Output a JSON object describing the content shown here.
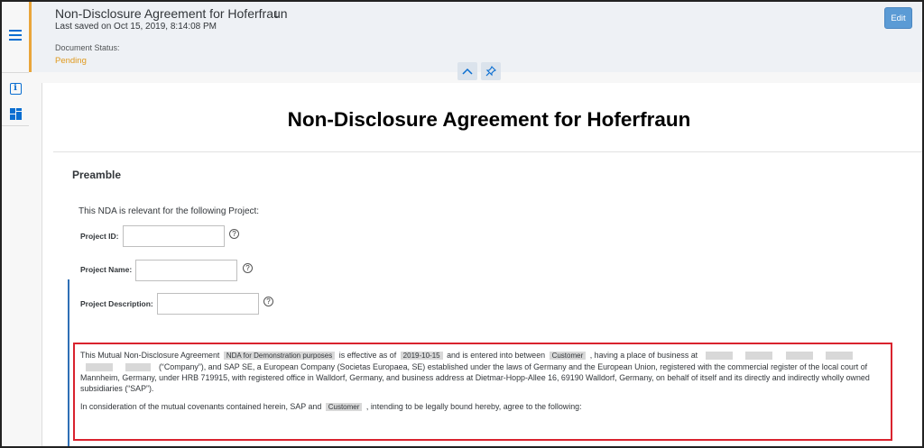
{
  "header": {
    "title": "Non-Disclosure Agreement for Hoferfraun",
    "count": "1",
    "last_saved": "Last saved on Oct 15, 2019, 8:14:08 PM",
    "status_label": "Document Status:",
    "status_value": "Pending",
    "edit_label": "Edit"
  },
  "document": {
    "heading": "Non-Disclosure Agreement for Hoferfraun",
    "section_title": "Preamble",
    "intro": "This NDA is relevant for the following Project:",
    "fields": {
      "project_id_label": "Project ID:",
      "project_name_label": "Project Name:",
      "project_description_label": "Project Description:",
      "help_glyph": "?"
    },
    "paragraph1": {
      "t1": "This Mutual Non-Disclosure Agreement",
      "tok_purpose": "NDA for Demonstration purposes",
      "t2": "is effective as of",
      "tok_date": "2019-10-15",
      "t3": "and is entered into between",
      "tok_customer": "Customer",
      "t4": ", having a place of business at",
      "t5": "(“Company”), and SAP SE, a European Company (Societas Europaea, SE) established under the laws of Germany and the European Union, registered with the commercial register of the local court of Mannheim, Germany, under HRB 719915, with registered office in Walldorf, Germany, and business address at Dietmar-Hopp-Allee 16, 69190 Walldorf, Germany, on behalf of itself and its directly and indirectly wholly owned subsidiaries (“SAP”)."
    },
    "paragraph2": {
      "t1": "In consideration of the mutual covenants contained herein, SAP and",
      "tok_customer": "Customer",
      "t2": ", intending to be legally bound hereby, agree to the following:"
    }
  },
  "colors": {
    "accent": "#0a6ed1",
    "status_pending": "#e09a1e",
    "highlight_border": "#d9232e",
    "edit_button": "#5b9bd5"
  },
  "icons": [
    "menu-icon",
    "info-icon",
    "layout-icon",
    "chevron-up-icon",
    "pin-icon",
    "help-icon"
  ]
}
